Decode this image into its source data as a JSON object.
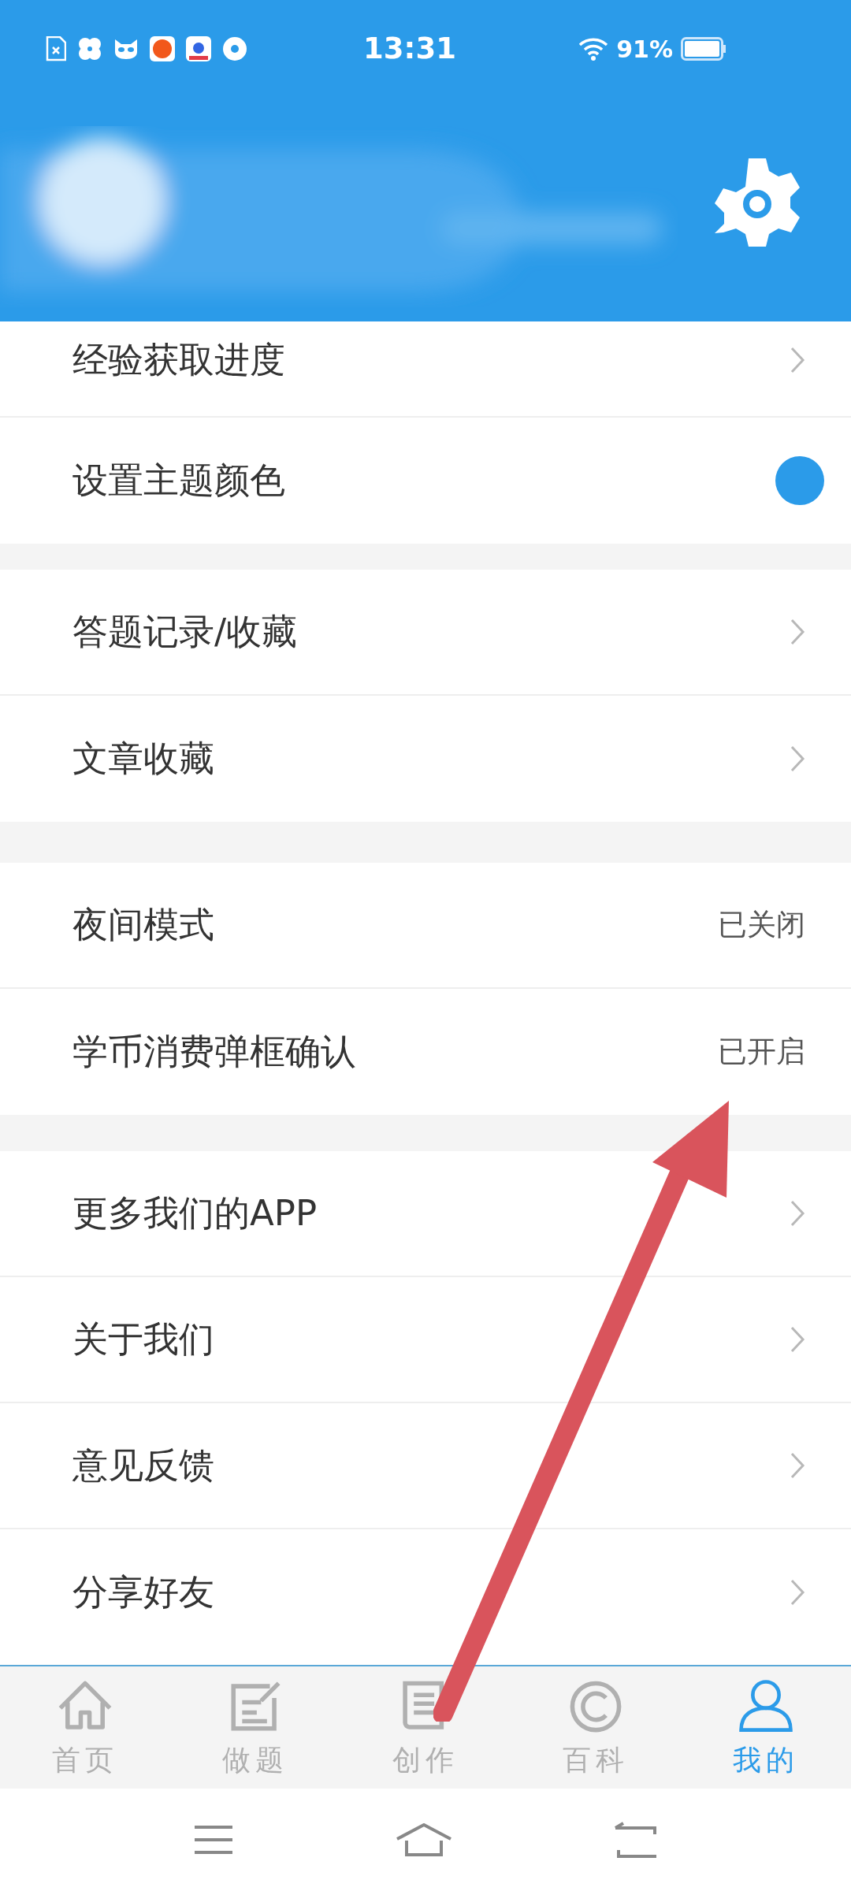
{
  "status_bar": {
    "time": "13:31",
    "battery": "91%"
  },
  "groups": [
    {
      "items": [
        {
          "label": "经验获取进度",
          "kind": "chevron"
        },
        {
          "label": "设置主题颜色",
          "kind": "color",
          "color": "#2b9be9"
        }
      ]
    },
    {
      "items": [
        {
          "label": "答题记录/收藏",
          "kind": "chevron"
        },
        {
          "label": "文章收藏",
          "kind": "chevron"
        }
      ]
    },
    {
      "items": [
        {
          "label": "夜间模式",
          "kind": "value",
          "value": "已关闭"
        },
        {
          "label": "学币消费弹框确认",
          "kind": "value",
          "value": "已开启"
        }
      ]
    },
    {
      "items": [
        {
          "label": "更多我们的APP",
          "kind": "chevron"
        },
        {
          "label": "关于我们",
          "kind": "chevron"
        },
        {
          "label": "意见反馈",
          "kind": "chevron"
        },
        {
          "label": "分享好友",
          "kind": "chevron"
        }
      ]
    }
  ],
  "tabs": [
    {
      "label": "首页",
      "kind": "home",
      "selected": false
    },
    {
      "label": "做题",
      "kind": "edit",
      "selected": false
    },
    {
      "label": "创作",
      "kind": "book",
      "selected": false
    },
    {
      "label": "百科",
      "kind": "copyright",
      "selected": false
    },
    {
      "label": "我的",
      "kind": "person",
      "selected": true
    }
  ]
}
